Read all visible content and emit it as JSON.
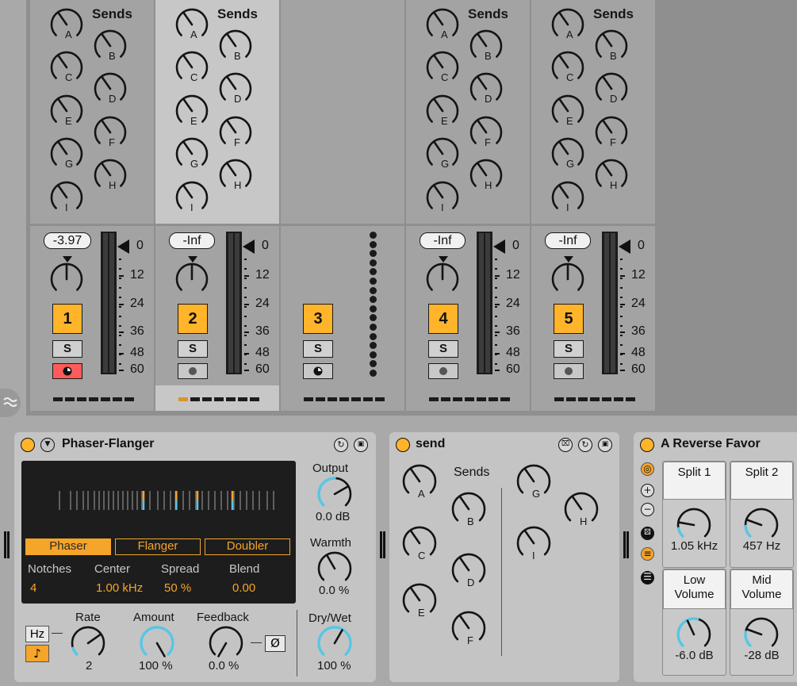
{
  "mixer": {
    "sends_title": "Sends",
    "send_letters": [
      "A",
      "B",
      "C",
      "D",
      "E",
      "F",
      "G",
      "H",
      "I"
    ],
    "meter_ticks": [
      "0",
      "12",
      "24",
      "36",
      "48",
      "60"
    ],
    "tracks": [
      {
        "number": "1",
        "volume": "-3.97",
        "solo": "S",
        "arm": "record-armed"
      },
      {
        "number": "2",
        "volume": "-Inf",
        "solo": "S",
        "arm": "dot"
      },
      {
        "number": "3",
        "volume": "",
        "solo": "S",
        "arm": "record-icon"
      },
      {
        "number": "4",
        "volume": "-Inf",
        "solo": "S",
        "arm": "dot"
      },
      {
        "number": "5",
        "volume": "-Inf",
        "solo": "S",
        "arm": "dot"
      }
    ]
  },
  "phaser": {
    "title": "Phaser-Flanger",
    "modes": [
      "Phaser",
      "Flanger",
      "Doubler"
    ],
    "params": {
      "notches": {
        "label": "Notches",
        "value": "4"
      },
      "center": {
        "label": "Center",
        "value": "1.00 kHz"
      },
      "spread": {
        "label": "Spread",
        "value": "50 %"
      },
      "blend": {
        "label": "Blend",
        "value": "0.00"
      }
    },
    "output": {
      "label": "Output",
      "value": "0.0 dB"
    },
    "warmth": {
      "label": "Warmth",
      "value": "0.0 %"
    },
    "drywet": {
      "label": "Dry/Wet",
      "value": "100 %"
    },
    "rate": {
      "label": "Rate",
      "value": "2"
    },
    "amount": {
      "label": "Amount",
      "value": "100 %"
    },
    "feedback": {
      "label": "Feedback",
      "value": "0.0 %"
    },
    "hz_button": "Hz",
    "note_button": "♪",
    "phase_button": "Ø",
    "accent": "#f5a52a"
  },
  "send_device": {
    "title": "send",
    "sends_title": "Sends",
    "letters": [
      "A",
      "B",
      "C",
      "D",
      "E",
      "F",
      "G",
      "H",
      "I"
    ]
  },
  "rack": {
    "title": "A Reverse Favor",
    "macros": [
      {
        "label": "Split 1",
        "value": "1.05 kHz"
      },
      {
        "label": "Split 2",
        "value": "457 Hz"
      },
      {
        "label": "Low Volume",
        "value": "-6.0 dB"
      },
      {
        "label": "Mid Volume",
        "value": "-28 dB"
      }
    ]
  }
}
